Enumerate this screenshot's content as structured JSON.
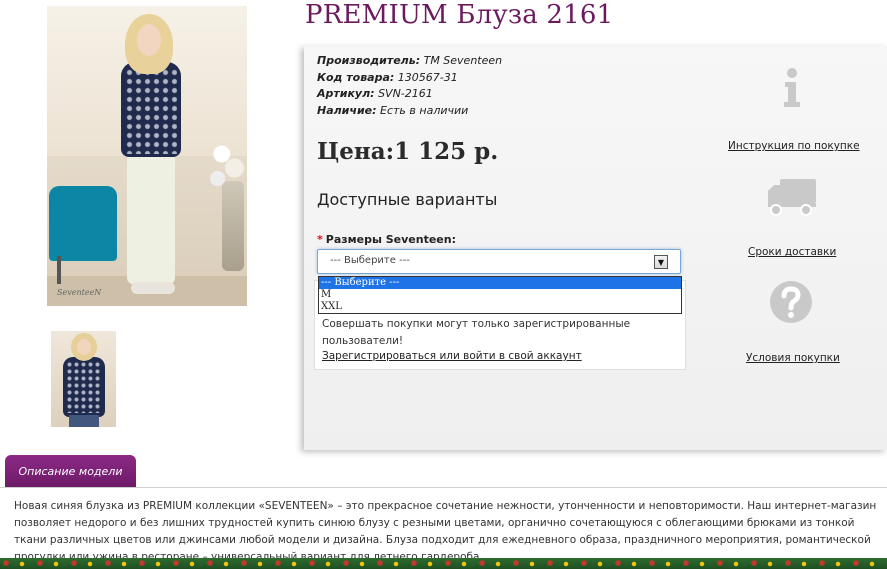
{
  "product": {
    "title": "PREMIUM Блуза 2161",
    "photo_signature": "SeventeeN"
  },
  "meta": [
    {
      "key": "Производитель:",
      "value": "TM Seventeen"
    },
    {
      "key": "Код товара:",
      "value": "130567-31"
    },
    {
      "key": "Артикул:",
      "value": "SVN-2161"
    },
    {
      "key": "Наличие:",
      "value": "Есть в наличии"
    }
  ],
  "price": "Цена:1 125 р.",
  "variants": {
    "title": "Доступные варианты",
    "required_mark": "*",
    "size_label": "Размеры Seventeen:",
    "selected": "--- Выберите ---",
    "options": [
      "--- Выберите ---",
      "M",
      "XXL"
    ]
  },
  "notice": {
    "text": "Совершать покупки могут только зарегистрированные пользователи!",
    "link": "Зарегистрироваться или войти в свой аккаунт"
  },
  "side_links": {
    "instructions": "Инструкция по покупке",
    "delivery": "Сроки доставки",
    "terms": "Условия покупки"
  },
  "description": {
    "tab_label": "Описание модели",
    "text": "Новая синяя блузка из PREMIUM коллекции «SEVENTEEN» – это прекрасное сочетание нежности, утонченности и неповторимости. Наш интернет-магазин позволяет недорого и без лишних трудностей купить синюю блузу с резными цветами, органично сочетающуюся с облегающими брюками из тонкой ткани различных цветов или джинсами любой модели и дизайна. Блуза подходит для ежедневного образа, праздничного мероприятия, романтической прогулки или ужина в ресторане – универсальный вариант для летнего гардероба."
  },
  "colors": {
    "title": "#6b1a5e",
    "tab": "#7a2075",
    "select_highlight": "#1e73e6",
    "required": "#dd1111"
  },
  "icons": [
    "info-icon",
    "truck-icon",
    "question-icon",
    "dropdown-arrow-icon"
  ]
}
